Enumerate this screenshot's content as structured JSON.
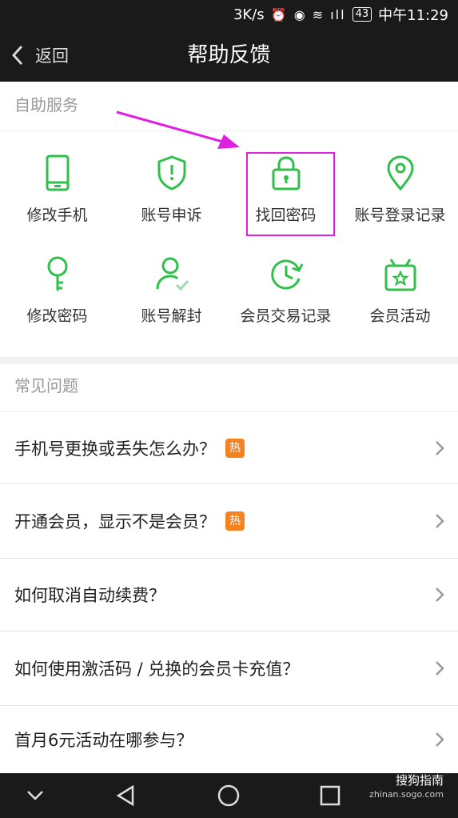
{
  "status_bar": {
    "net_speed": "3K/s",
    "battery": "43",
    "time": "中午11:29"
  },
  "navbar": {
    "back_label": "返回",
    "title": "帮助反馈"
  },
  "self_service": {
    "header": "自助服务",
    "items": [
      {
        "label": "修改手机",
        "icon": "phone-icon"
      },
      {
        "label": "账号申诉",
        "icon": "shield-alert-icon"
      },
      {
        "label": "找回密码",
        "icon": "lock-icon"
      },
      {
        "label": "账号登录记录",
        "icon": "location-pin-icon"
      },
      {
        "label": "修改密码",
        "icon": "key-icon"
      },
      {
        "label": "账号解封",
        "icon": "user-check-icon"
      },
      {
        "label": "会员交易记录",
        "icon": "clock-refresh-icon"
      },
      {
        "label": "会员活动",
        "icon": "gift-box-icon"
      }
    ]
  },
  "faq": {
    "header": "常见问题",
    "hot_badge": "热",
    "items": [
      {
        "question": "手机号更换或丢失怎么办？",
        "hot": true
      },
      {
        "question": "开通会员，显示不是会员？",
        "hot": true
      },
      {
        "question": "如何取消自动续费？",
        "hot": false
      },
      {
        "question": "如何使用激活码 / 兑换的会员卡充值？",
        "hot": false
      },
      {
        "question": "首月6元活动在哪参与？",
        "hot": false
      }
    ]
  },
  "watermark": {
    "main": "搜狗指南",
    "sub": "zhinan.sogo.com"
  },
  "colors": {
    "icon_green": "#2fbf4b",
    "hot_orange": "#f5821f",
    "annotation_magenta": "#e020e0",
    "dark_bar": "#1a1a1a"
  }
}
